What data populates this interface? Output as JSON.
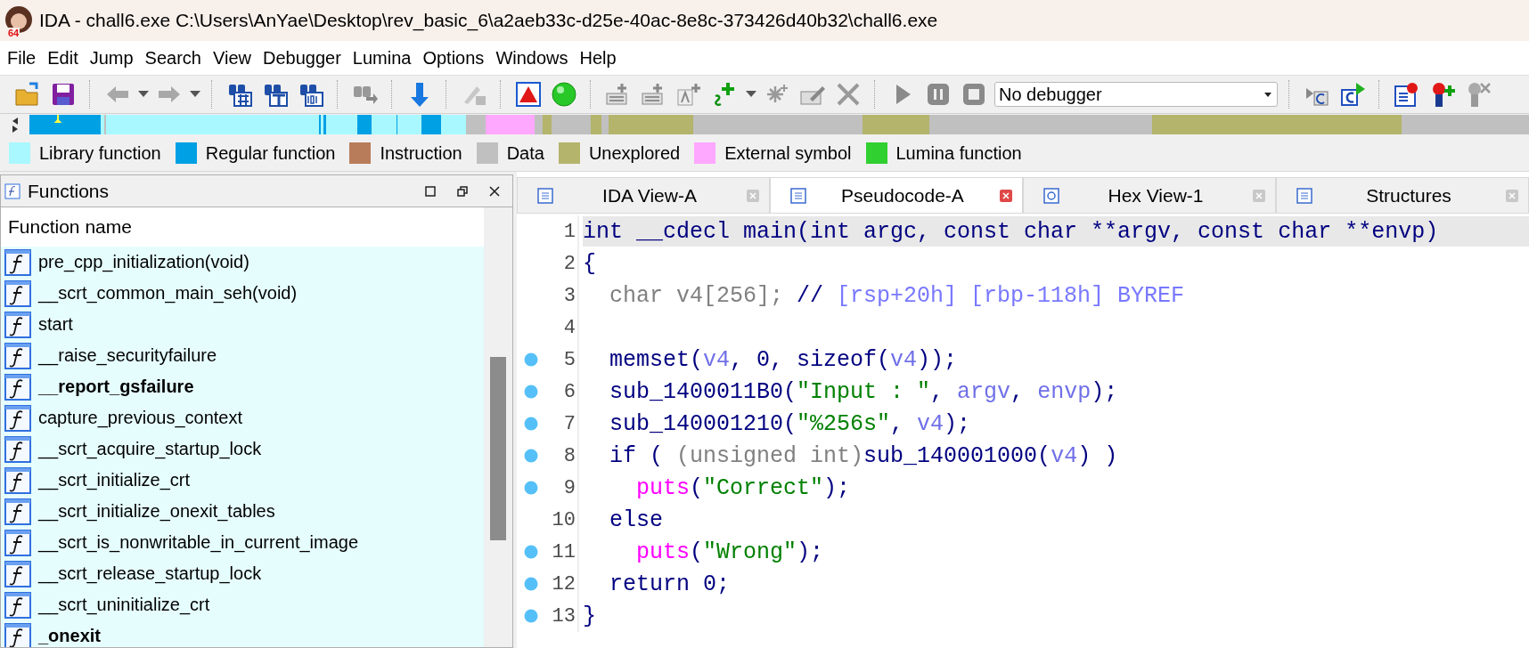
{
  "window": {
    "title": "IDA - chall6.exe C:\\Users\\AnYae\\Desktop\\rev_basic_6\\a2aeb33c-d25e-40ac-8e8c-373426d40b32\\chall6.exe",
    "logo_badge": "64"
  },
  "menu": [
    "File",
    "Edit",
    "Jump",
    "Search",
    "View",
    "Debugger",
    "Lumina",
    "Options",
    "Windows",
    "Help"
  ],
  "toolbar": {
    "debugger_select": "No debugger"
  },
  "legend": [
    {
      "label": "Library function",
      "color": "#aaf8ff"
    },
    {
      "label": "Regular function",
      "color": "#00a0e4"
    },
    {
      "label": "Instruction",
      "color": "#b87c5a"
    },
    {
      "label": "Data",
      "color": "#c0c0c0"
    },
    {
      "label": "Unexplored",
      "color": "#b4b46c"
    },
    {
      "label": "External symbol",
      "color": "#ffa8ff"
    },
    {
      "label": "Lumina function",
      "color": "#30d030"
    }
  ],
  "functions_panel": {
    "title": "Functions",
    "column": "Function name",
    "rows": [
      {
        "name": "pre_cpp_initialization(void)",
        "bold": false
      },
      {
        "name": "__scrt_common_main_seh(void)",
        "bold": false
      },
      {
        "name": "start",
        "bold": false
      },
      {
        "name": "__raise_securityfailure",
        "bold": false
      },
      {
        "name": "__report_gsfailure",
        "bold": true
      },
      {
        "name": "capture_previous_context",
        "bold": false
      },
      {
        "name": "__scrt_acquire_startup_lock",
        "bold": false
      },
      {
        "name": "__scrt_initialize_crt",
        "bold": false
      },
      {
        "name": "__scrt_initialize_onexit_tables",
        "bold": false
      },
      {
        "name": "__scrt_is_nonwritable_in_current_image",
        "bold": false
      },
      {
        "name": "__scrt_release_startup_lock",
        "bold": false
      },
      {
        "name": "__scrt_uninitialize_crt",
        "bold": false
      },
      {
        "name": "_onexit",
        "bold": true
      }
    ]
  },
  "tabs": [
    {
      "label": "IDA View-A",
      "selected": false
    },
    {
      "label": "Pseudocode-A",
      "selected": true
    },
    {
      "label": "Hex View-1",
      "selected": false
    },
    {
      "label": "Structures",
      "selected": false
    }
  ],
  "pseudocode": {
    "lines": [
      {
        "number": "1",
        "dot": false,
        "current": true,
        "tokens": [
          {
            "kind": "code",
            "text": "int __cdecl main(int argc, const char **argv, const char **envp)"
          }
        ]
      },
      {
        "number": "2",
        "dot": false,
        "current": false,
        "tokens": [
          {
            "kind": "code",
            "text": "{"
          }
        ]
      },
      {
        "number": "3",
        "dot": false,
        "current": false,
        "tokens": [
          {
            "kind": "decl",
            "text": "  char v4[256]; "
          },
          {
            "kind": "code",
            "text": "// "
          },
          {
            "kind": "comment",
            "text": "[rsp+20h] [rbp-118h] BYREF"
          }
        ]
      },
      {
        "number": "4",
        "dot": false,
        "current": false
      },
      {
        "number": "5",
        "dot": true,
        "current": false,
        "tokens": [
          {
            "kind": "code",
            "text": "  memset("
          },
          {
            "kind": "var",
            "text": "v4"
          },
          {
            "kind": "code",
            "text": ", 0, sizeof("
          },
          {
            "kind": "var",
            "text": "v4"
          },
          {
            "kind": "code",
            "text": "));"
          }
        ]
      },
      {
        "number": "6",
        "dot": true,
        "current": false,
        "tokens": [
          {
            "kind": "code",
            "text": "  sub_1400011B0("
          },
          {
            "kind": "string",
            "text": "\"Input : \""
          },
          {
            "kind": "code",
            "text": ", "
          },
          {
            "kind": "var",
            "text": "argv"
          },
          {
            "kind": "code",
            "text": ", "
          },
          {
            "kind": "var",
            "text": "envp"
          },
          {
            "kind": "code",
            "text": ");"
          }
        ]
      },
      {
        "number": "7",
        "dot": true,
        "current": false,
        "tokens": [
          {
            "kind": "code",
            "text": "  sub_140001210("
          },
          {
            "kind": "string",
            "text": "\"%256s\""
          },
          {
            "kind": "code",
            "text": ", "
          },
          {
            "kind": "var",
            "text": "v4"
          },
          {
            "kind": "code",
            "text": ");"
          }
        ]
      },
      {
        "number": "8",
        "dot": true,
        "current": false,
        "tokens": [
          {
            "kind": "code",
            "text": "  if ( "
          },
          {
            "kind": "decl",
            "text": "(unsigned int)"
          },
          {
            "kind": "code",
            "text": "sub_140001000("
          },
          {
            "kind": "var",
            "text": "v4"
          },
          {
            "kind": "code",
            "text": ") )"
          }
        ]
      },
      {
        "number": "9",
        "dot": true,
        "current": false,
        "tokens": [
          {
            "kind": "import",
            "text": "    puts"
          },
          {
            "kind": "code",
            "text": "("
          },
          {
            "kind": "string",
            "text": "\"Correct\""
          },
          {
            "kind": "code",
            "text": ");"
          }
        ]
      },
      {
        "number": "10",
        "dot": false,
        "current": false,
        "tokens": [
          {
            "kind": "code",
            "text": "  else"
          }
        ]
      },
      {
        "number": "11",
        "dot": true,
        "current": false,
        "tokens": [
          {
            "kind": "import",
            "text": "    puts"
          },
          {
            "kind": "code",
            "text": "("
          },
          {
            "kind": "string",
            "text": "\"Wrong\""
          },
          {
            "kind": "code",
            "text": ");"
          }
        ]
      },
      {
        "number": "12",
        "dot": true,
        "current": false,
        "tokens": [
          {
            "kind": "code",
            "text": "  return 0;"
          }
        ]
      },
      {
        "number": "13",
        "dot": true,
        "current": false,
        "tokens": [
          {
            "kind": "code",
            "text": "}"
          }
        ]
      }
    ]
  }
}
